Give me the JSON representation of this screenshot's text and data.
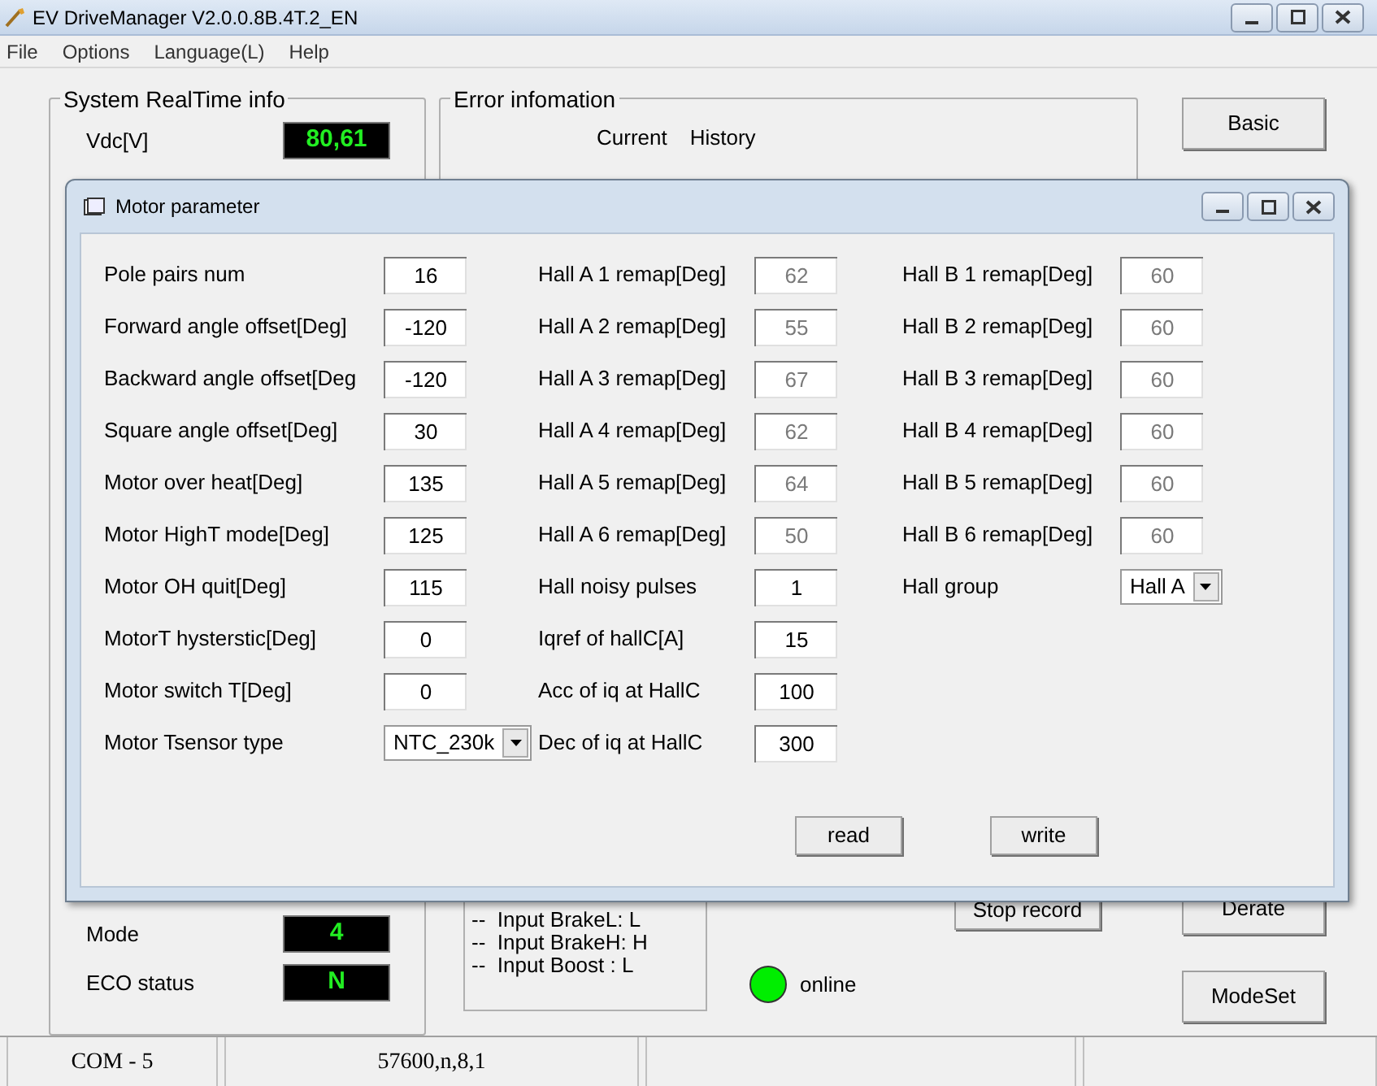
{
  "window": {
    "title": "EV DriveManager V2.0.0.8B.4T.2_EN"
  },
  "menu": [
    "File",
    "Options",
    "Language(L)",
    "Help"
  ],
  "realtime": {
    "title": "System RealTime info",
    "top": [
      {
        "label": "Vdc[V]",
        "value": "80,61"
      }
    ],
    "bottom": [
      {
        "label": "Mode",
        "value": "4"
      },
      {
        "label": "ECO status",
        "value": "N"
      }
    ]
  },
  "error_info": {
    "title": "Error infomation",
    "columns": [
      "Current",
      "History"
    ]
  },
  "inputs": [
    "--  Input BrakeL: L",
    "--  Input BrakeH: H",
    "--  Input Boost : L"
  ],
  "connection": {
    "label": "online",
    "online": true
  },
  "stop_button": "Stop record",
  "side_buttons_top": [
    "Basic"
  ],
  "side_buttons_bottom": [
    "Derate",
    "ModeSet"
  ],
  "status_bar": [
    "COM - 5",
    "57600,n,8,1"
  ],
  "dialog": {
    "title": "Motor parameter",
    "columns": [
      [
        {
          "label": "Pole pairs num",
          "value": "16",
          "kind": "input",
          "disabled": false
        },
        {
          "label": "Forward angle offset[Deg]",
          "value": "-120",
          "kind": "input",
          "disabled": false
        },
        {
          "label": "Backward angle offset[Deg",
          "value": "-120",
          "kind": "input",
          "disabled": false
        },
        {
          "label": "Square angle offset[Deg]",
          "value": "30",
          "kind": "input",
          "disabled": false
        },
        {
          "label": "Motor over heat[Deg]",
          "value": "135",
          "kind": "input",
          "disabled": false
        },
        {
          "label": "Motor HighT mode[Deg]",
          "value": "125",
          "kind": "input",
          "disabled": false
        },
        {
          "label": "Motor OH quit[Deg]",
          "value": "115",
          "kind": "input",
          "disabled": false
        },
        {
          "label": "MotorT hysterstic[Deg]",
          "value": "0",
          "kind": "input",
          "disabled": false
        },
        {
          "label": "Motor switch T[Deg]",
          "value": "0",
          "kind": "input",
          "disabled": false
        },
        {
          "label": "Motor Tsensor type",
          "value": "NTC_230k",
          "kind": "select"
        }
      ],
      [
        {
          "label": "Hall A 1 remap[Deg]",
          "value": "62",
          "kind": "input",
          "disabled": true
        },
        {
          "label": "Hall A 2 remap[Deg]",
          "value": "55",
          "kind": "input",
          "disabled": true
        },
        {
          "label": "Hall A 3 remap[Deg]",
          "value": "67",
          "kind": "input",
          "disabled": true
        },
        {
          "label": "Hall A 4 remap[Deg]",
          "value": "62",
          "kind": "input",
          "disabled": true
        },
        {
          "label": "Hall A 5 remap[Deg]",
          "value": "64",
          "kind": "input",
          "disabled": true
        },
        {
          "label": "Hall A 6 remap[Deg]",
          "value": "50",
          "kind": "input",
          "disabled": true
        },
        {
          "label": "Hall noisy pulses",
          "value": "1",
          "kind": "input",
          "disabled": false
        },
        {
          "label": "Iqref of hallC[A]",
          "value": "15",
          "kind": "input",
          "disabled": false
        },
        {
          "label": "Acc of iq at HallC",
          "value": "100",
          "kind": "input",
          "disabled": false
        },
        {
          "label": "Dec of iq at HallC",
          "value": "300",
          "kind": "input",
          "disabled": false
        }
      ],
      [
        {
          "label": "Hall B 1 remap[Deg]",
          "value": "60",
          "kind": "input",
          "disabled": true
        },
        {
          "label": "Hall B 2 remap[Deg]",
          "value": "60",
          "kind": "input",
          "disabled": true
        },
        {
          "label": "Hall B 3 remap[Deg]",
          "value": "60",
          "kind": "input",
          "disabled": true
        },
        {
          "label": "Hall B 4 remap[Deg]",
          "value": "60",
          "kind": "input",
          "disabled": true
        },
        {
          "label": "Hall B 5 remap[Deg]",
          "value": "60",
          "kind": "input",
          "disabled": true
        },
        {
          "label": "Hall B 6 remap[Deg]",
          "value": "60",
          "kind": "input",
          "disabled": true
        },
        {
          "label": "Hall group",
          "value": "Hall A",
          "kind": "select"
        }
      ]
    ],
    "buttons": [
      "read",
      "write"
    ]
  }
}
